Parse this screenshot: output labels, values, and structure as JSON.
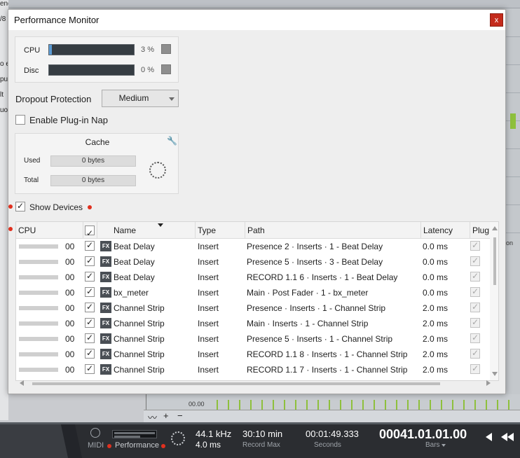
{
  "background": {
    "left_labels": [
      "ength",
      "/8",
      "o e",
      "pu",
      "lt",
      "uo"
    ],
    "arrange_timecode": "00.00",
    "ruler_fragment": "on"
  },
  "dialog": {
    "title": "Performance Monitor",
    "close_label": "x",
    "meters": {
      "cpu_label": "CPU",
      "cpu_value": "3 %",
      "cpu_fraction": 0.03,
      "disc_label": "Disc",
      "disc_value": "0 %",
      "disc_fraction": 0.0
    },
    "dropout": {
      "label": "Dropout Protection",
      "value": "Medium"
    },
    "plugin_nap": {
      "label": "Enable Plug-in Nap",
      "checked": false
    },
    "cache": {
      "title": "Cache",
      "used_label": "Used",
      "used_value": "0 bytes",
      "total_label": "Total",
      "total_value": "0 bytes"
    },
    "show_devices": {
      "label": "Show Devices",
      "checked": true
    },
    "table": {
      "columns": [
        "CPU",
        "Name",
        "Type",
        "Path",
        "Latency",
        "Plug"
      ],
      "rows": [
        {
          "cpu": "00",
          "enabled": true,
          "badge": "FX",
          "name": "Beat Delay",
          "type": "Insert",
          "path": "Presence 2 · Inserts · 1 - Beat Delay",
          "latency": "0.0 ms"
        },
        {
          "cpu": "00",
          "enabled": true,
          "badge": "FX",
          "name": "Beat Delay",
          "type": "Insert",
          "path": "Presence 5 · Inserts · 3 - Beat Delay",
          "latency": "0.0 ms"
        },
        {
          "cpu": "00",
          "enabled": true,
          "badge": "FX",
          "name": "Beat Delay",
          "type": "Insert",
          "path": "RECORD 1.1 6 · Inserts · 1 - Beat Delay",
          "latency": "0.0 ms"
        },
        {
          "cpu": "00",
          "enabled": true,
          "badge": "FX",
          "name": "bx_meter",
          "type": "Insert",
          "path": "Main · Post Fader · 1 - bx_meter",
          "latency": "0.0 ms"
        },
        {
          "cpu": "00",
          "enabled": true,
          "badge": "FX",
          "name": "Channel Strip",
          "type": "Insert",
          "path": "Presence · Inserts · 1 - Channel Strip",
          "latency": "2.0 ms"
        },
        {
          "cpu": "00",
          "enabled": true,
          "badge": "FX",
          "name": "Channel Strip",
          "type": "Insert",
          "path": "Main · Inserts · 1 - Channel Strip",
          "latency": "2.0 ms"
        },
        {
          "cpu": "00",
          "enabled": true,
          "badge": "FX",
          "name": "Channel Strip",
          "type": "Insert",
          "path": "Presence 5 · Inserts · 1 - Channel Strip",
          "latency": "2.0 ms"
        },
        {
          "cpu": "00",
          "enabled": true,
          "badge": "FX",
          "name": "Channel Strip",
          "type": "Insert",
          "path": "RECORD 1.1 8 · Inserts · 1 - Channel Strip",
          "latency": "2.0 ms"
        },
        {
          "cpu": "00",
          "enabled": true,
          "badge": "FX",
          "name": "Channel Strip",
          "type": "Insert",
          "path": "RECORD 1.1 7 · Inserts · 1 - Channel Strip",
          "latency": "2.0 ms"
        }
      ]
    }
  },
  "transport": {
    "midi_label": "MIDI",
    "performance_label": "Performance",
    "sample_rate": "44.1 kHz",
    "latency": "4.0 ms",
    "record_time": "30:10 min",
    "record_time_label": "Record Max",
    "seconds_value": "00:01:49.333",
    "seconds_label": "Seconds",
    "bars_value": "00041.01.01.00",
    "bars_label": "Bars"
  },
  "colors": {
    "accent": "#5b9bd5",
    "close_red": "#c42b1c",
    "marker_red": "#e0301e",
    "transport_bg": "#2b2d31"
  }
}
